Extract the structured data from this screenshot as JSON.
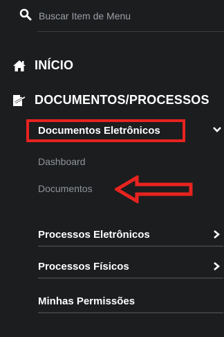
{
  "search": {
    "placeholder": "Buscar Item de Menu"
  },
  "nav": {
    "inicio": {
      "label": "INÍCIO"
    },
    "documentos_processos": {
      "label": "DOCUMENTOS/PROCESSOS"
    }
  },
  "submenu": {
    "documentos_eletronicos": {
      "label": "Documentos Eletrônicos",
      "children": [
        {
          "label": "Dashboard"
        },
        {
          "label": "Documentos"
        }
      ]
    },
    "items": [
      {
        "label": "Processos Eletrônicos"
      },
      {
        "label": "Processos Físicos"
      },
      {
        "label": "Minhas Permissões"
      }
    ]
  },
  "colors": {
    "background": "#1c1d1f",
    "highlight": "#e8231f",
    "muted_text": "#8f9499"
  }
}
